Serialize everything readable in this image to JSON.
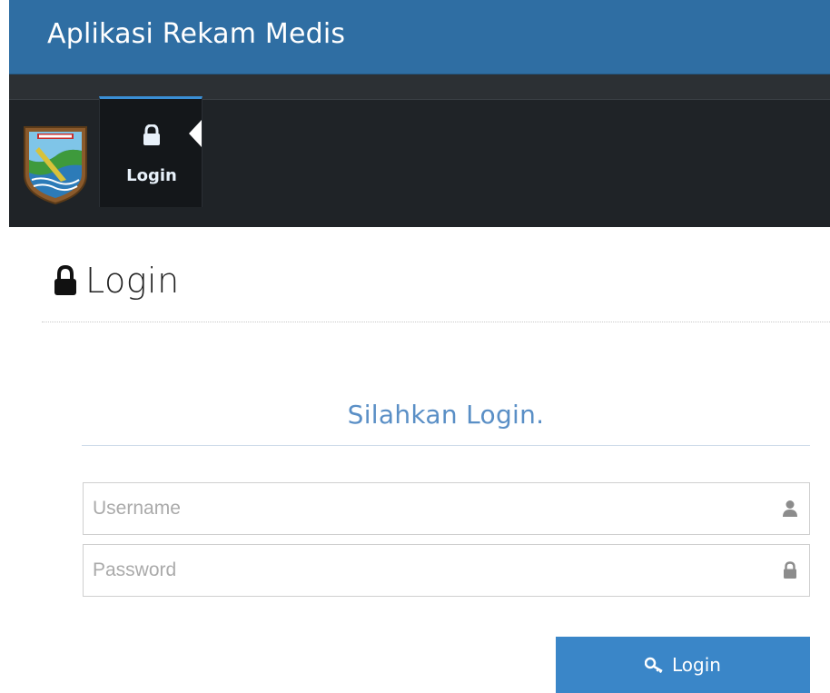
{
  "header": {
    "title": "Aplikasi Rekam Medis",
    "color": "#2f6ea3"
  },
  "navbar": {
    "logo_icon": "regional-crest-logo",
    "tabs": [
      {
        "label": "Login",
        "icon": "lock-icon",
        "active": true
      }
    ],
    "accent_color": "#3a8fd6"
  },
  "page": {
    "title": "Login",
    "title_icon": "lock-icon"
  },
  "login_form": {
    "heading": "Silahkan Login.",
    "username": {
      "placeholder": "Username",
      "value": "",
      "icon": "user-icon"
    },
    "password": {
      "placeholder": "Password",
      "value": "",
      "icon": "lock-icon"
    },
    "submit": {
      "label": "Login",
      "icon": "key-icon",
      "color": "#3a86c8"
    }
  }
}
